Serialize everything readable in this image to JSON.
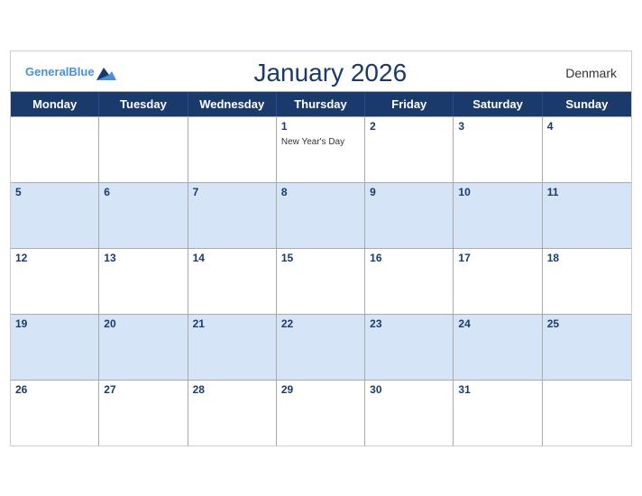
{
  "header": {
    "logo_general": "General",
    "logo_blue": "Blue",
    "month_title": "January 2026",
    "country": "Denmark"
  },
  "day_headers": [
    "Monday",
    "Tuesday",
    "Wednesday",
    "Thursday",
    "Friday",
    "Saturday",
    "Sunday"
  ],
  "weeks": [
    [
      {
        "date": "",
        "event": "",
        "empty": true
      },
      {
        "date": "",
        "event": "",
        "empty": true
      },
      {
        "date": "",
        "event": "",
        "empty": true
      },
      {
        "date": "1",
        "event": "New Year's Day",
        "empty": false
      },
      {
        "date": "2",
        "event": "",
        "empty": false
      },
      {
        "date": "3",
        "event": "",
        "empty": false
      },
      {
        "date": "4",
        "event": "",
        "empty": false
      }
    ],
    [
      {
        "date": "5",
        "event": "",
        "empty": false
      },
      {
        "date": "6",
        "event": "",
        "empty": false
      },
      {
        "date": "7",
        "event": "",
        "empty": false
      },
      {
        "date": "8",
        "event": "",
        "empty": false
      },
      {
        "date": "9",
        "event": "",
        "empty": false
      },
      {
        "date": "10",
        "event": "",
        "empty": false
      },
      {
        "date": "11",
        "event": "",
        "empty": false
      }
    ],
    [
      {
        "date": "12",
        "event": "",
        "empty": false
      },
      {
        "date": "13",
        "event": "",
        "empty": false
      },
      {
        "date": "14",
        "event": "",
        "empty": false
      },
      {
        "date": "15",
        "event": "",
        "empty": false
      },
      {
        "date": "16",
        "event": "",
        "empty": false
      },
      {
        "date": "17",
        "event": "",
        "empty": false
      },
      {
        "date": "18",
        "event": "",
        "empty": false
      }
    ],
    [
      {
        "date": "19",
        "event": "",
        "empty": false
      },
      {
        "date": "20",
        "event": "",
        "empty": false
      },
      {
        "date": "21",
        "event": "",
        "empty": false
      },
      {
        "date": "22",
        "event": "",
        "empty": false
      },
      {
        "date": "23",
        "event": "",
        "empty": false
      },
      {
        "date": "24",
        "event": "",
        "empty": false
      },
      {
        "date": "25",
        "event": "",
        "empty": false
      }
    ],
    [
      {
        "date": "26",
        "event": "",
        "empty": false
      },
      {
        "date": "27",
        "event": "",
        "empty": false
      },
      {
        "date": "28",
        "event": "",
        "empty": false
      },
      {
        "date": "29",
        "event": "",
        "empty": false
      },
      {
        "date": "30",
        "event": "",
        "empty": false
      },
      {
        "date": "31",
        "event": "",
        "empty": false
      },
      {
        "date": "",
        "event": "",
        "empty": true
      }
    ]
  ],
  "colors": {
    "header_bg": "#1a3a6b",
    "row_even_bg": "#d6e4f7",
    "row_odd_bg": "#ffffff"
  }
}
